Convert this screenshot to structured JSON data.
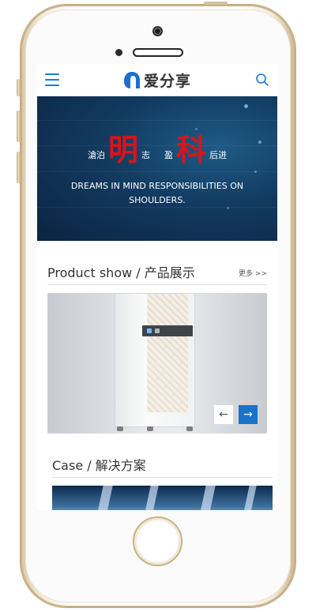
{
  "header": {
    "logo_text": "爱分享",
    "menu_icon": "hamburger-icon",
    "search_icon": "search-icon",
    "accent_color": "#1a7cd1"
  },
  "banner": {
    "line_parts": [
      "滄泊",
      "明",
      "志",
      "盈",
      "科",
      "后进"
    ],
    "slogan_en": "DREAMS IN MIND  RESPONSIBILITIES ON SHOULDERS.",
    "highlight_color": "#d9141a"
  },
  "products": {
    "title": "Product show / 产品展示",
    "more": "更多 >>",
    "prev_label": "←",
    "next_label": "→"
  },
  "cases": {
    "title": "Case / 解决方案"
  }
}
